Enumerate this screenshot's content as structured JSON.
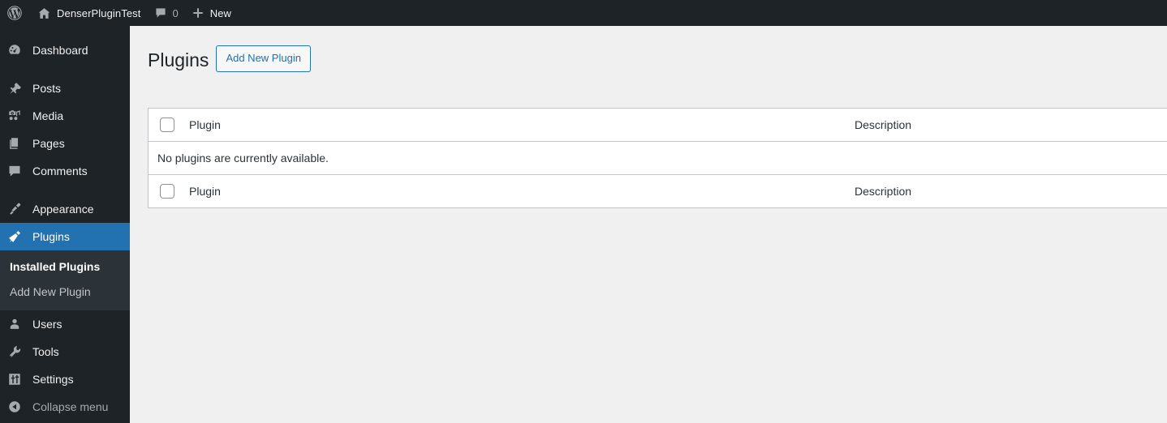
{
  "adminbar": {
    "items": [
      {
        "name": "wp-logo",
        "icon": "wordpress-icon",
        "label": ""
      },
      {
        "name": "site-name",
        "icon": "home-icon",
        "label": "DenserPluginTest"
      },
      {
        "name": "comments",
        "icon": "comment-bubble-icon",
        "label": "0"
      },
      {
        "name": "new-content",
        "icon": "plus-icon",
        "label": "New"
      }
    ]
  },
  "sidebar": {
    "items": [
      {
        "label": "Dashboard",
        "icon": "dashboard-gauge-icon",
        "current": false
      },
      {
        "label": "Posts",
        "icon": "pin-icon",
        "current": false
      },
      {
        "label": "Media",
        "icon": "media-camera-music-icon",
        "current": false
      },
      {
        "label": "Pages",
        "icon": "pages-icon",
        "current": false
      },
      {
        "label": "Comments",
        "icon": "comment-bubble-icon",
        "current": false
      },
      {
        "label": "Appearance",
        "icon": "paint-brush-icon",
        "current": false
      },
      {
        "label": "Plugins",
        "icon": "plug-icon",
        "current": true
      },
      {
        "label": "Users",
        "icon": "user-icon",
        "current": false
      },
      {
        "label": "Tools",
        "icon": "wrench-icon",
        "current": false
      },
      {
        "label": "Settings",
        "icon": "sliders-icon",
        "current": false
      }
    ],
    "plugins_submenu": [
      {
        "label": "Installed Plugins",
        "current": true
      },
      {
        "label": "Add New Plugin",
        "current": false
      }
    ],
    "collapse": {
      "label": "Collapse menu",
      "icon": "collapse-arrow-left-icon"
    }
  },
  "main": {
    "title": "Plugins",
    "add_new_label": "Add New Plugin",
    "table": {
      "columns": {
        "checkbox": "",
        "name": "Plugin",
        "description": "Description"
      },
      "empty_message": "No plugins are currently available."
    }
  },
  "colors": {
    "accent": "#2271b1",
    "adminbar_bg": "#1d2327",
    "sidebar_bg": "#1d2327",
    "submenu_bg": "#2c3338",
    "content_bg": "#f0f0f1",
    "table_border": "#c3c4c7"
  }
}
